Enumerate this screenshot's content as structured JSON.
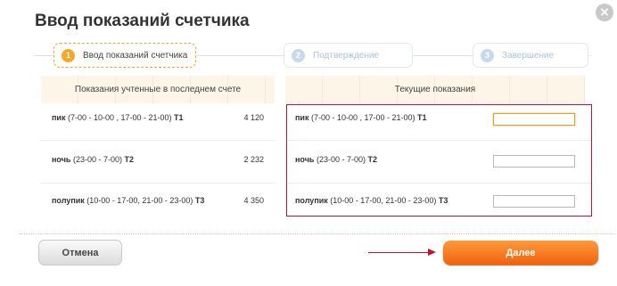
{
  "dialog": {
    "title": "Ввод показаний счетчика",
    "close_icon": "×"
  },
  "steps": [
    {
      "num": "1",
      "label": "Ввод показаний счетчика",
      "state": "active"
    },
    {
      "num": "2",
      "label": "Подтверждение",
      "state": "inactive"
    },
    {
      "num": "3",
      "label": "Завершение",
      "state": "inactive"
    }
  ],
  "left_table": {
    "header": "Показания учтенные в последнем счете",
    "rows": [
      {
        "name": "пик",
        "detail": " (7-00 - 10-00 , 17-00 - 21-00) ",
        "tariff": "T1",
        "value": "4 120"
      },
      {
        "name": "ночь",
        "detail": " (23-00 - 7-00) ",
        "tariff": "T2",
        "value": "2 232"
      },
      {
        "name": "полупик",
        "detail": " (10-00 - 17-00, 21-00 - 23-00) ",
        "tariff": "T3",
        "value": "4 350"
      }
    ]
  },
  "right_table": {
    "header": "Текущие показания",
    "rows": [
      {
        "name": "пик",
        "detail": " (7-00 - 10-00 , 17-00 - 21-00) ",
        "tariff": "T1",
        "input_value": ""
      },
      {
        "name": "ночь",
        "detail": " (23-00 - 7-00) ",
        "tariff": "T2",
        "input_value": ""
      },
      {
        "name": "полупик",
        "detail": " (10-00 - 17-00, 21-00 - 23-00) ",
        "tariff": "T3",
        "input_value": ""
      }
    ]
  },
  "buttons": {
    "cancel": "Отмена",
    "next": "Далее"
  },
  "colors": {
    "accent": "#f3a925",
    "highlight": "#c8102e",
    "next_button": "#f0620e"
  }
}
